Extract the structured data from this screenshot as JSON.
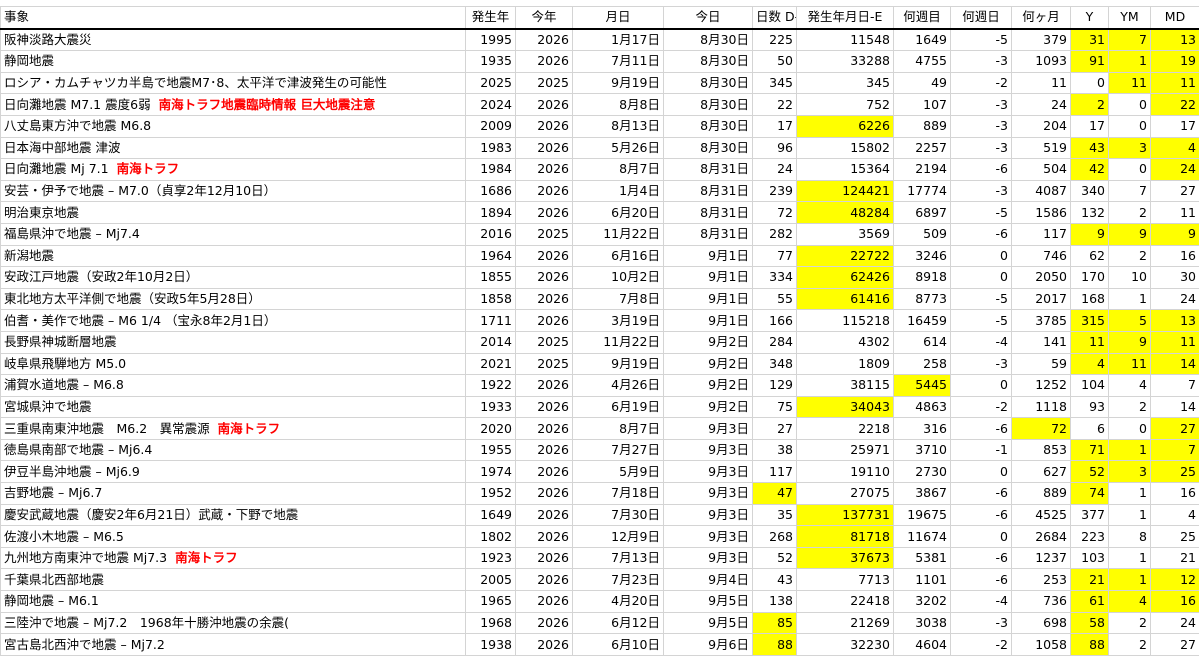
{
  "colors": {
    "highlight": "#ffff00",
    "alert_text": "#ff0000",
    "grid": "#d4d4d4"
  },
  "headers": [
    "事象",
    "発生年",
    "今年",
    "月日",
    "今日",
    "日数 D-E",
    "発生年月日-E",
    "何週目",
    "何週日",
    "何ヶ月",
    "Y",
    "YM",
    "MD"
  ],
  "rows": [
    {
      "event": "阪神淡路大震災",
      "tag": "",
      "birth_year": "1995",
      "this_year": "2026",
      "md": "1月17日",
      "today": "8月30日",
      "days": "225",
      "total_days": "11548",
      "weeks": "1649",
      "weekday": "-5",
      "months": "379",
      "y": "31",
      "ym": "7",
      "d": "13",
      "hl": [
        "y",
        "ym",
        "d"
      ],
      "red": []
    },
    {
      "event": "静岡地震",
      "tag": "",
      "birth_year": "1935",
      "this_year": "2026",
      "md": "7月11日",
      "today": "8月30日",
      "days": "50",
      "total_days": "33288",
      "weeks": "4755",
      "weekday": "-3",
      "months": "1093",
      "y": "91",
      "ym": "1",
      "d": "19",
      "hl": [
        "y",
        "ym",
        "d"
      ],
      "red": [
        "y",
        "ym",
        "d"
      ]
    },
    {
      "event": "ロシア・カムチャツカ半島で地震M7･8、太平洋で津波発生の可能性",
      "tag": "",
      "birth_year": "2025",
      "this_year": "2025",
      "md": "9月19日",
      "today": "8月30日",
      "days": "345",
      "total_days": "345",
      "weeks": "49",
      "weekday": "-2",
      "months": "11",
      "y": "0",
      "ym": "11",
      "d": "11",
      "hl": [
        "ym",
        "d"
      ],
      "red": []
    },
    {
      "event": "日向灘地震 M7.1 震度6弱",
      "tag": "南海トラフ地震臨時情報 巨大地震注意",
      "birth_year": "2024",
      "this_year": "2026",
      "md": "8月8日",
      "today": "8月30日",
      "days": "22",
      "total_days": "752",
      "weeks": "107",
      "weekday": "-3",
      "months": "24",
      "y": "2",
      "ym": "0",
      "d": "22",
      "hl": [
        "y",
        "d"
      ],
      "red": []
    },
    {
      "event": "八丈島東方沖で地震 M6.8",
      "tag": "",
      "birth_year": "2009",
      "this_year": "2026",
      "md": "8月13日",
      "today": "8月30日",
      "days": "17",
      "total_days": "6226",
      "weeks": "889",
      "weekday": "-3",
      "months": "204",
      "y": "17",
      "ym": "0",
      "d": "17",
      "hl": [
        "total_days"
      ],
      "red": []
    },
    {
      "event": "日本海中部地震 津波",
      "tag": "",
      "birth_year": "1983",
      "this_year": "2026",
      "md": "5月26日",
      "today": "8月30日",
      "days": "96",
      "total_days": "15802",
      "weeks": "2257",
      "weekday": "-3",
      "months": "519",
      "y": "43",
      "ym": "3",
      "d": "4",
      "hl": [
        "y",
        "ym",
        "d"
      ],
      "red": []
    },
    {
      "event": "日向灘地震 Mj 7.1",
      "tag": "南海トラフ",
      "birth_year": "1984",
      "this_year": "2026",
      "md": "8月7日",
      "today": "8月31日",
      "days": "24",
      "total_days": "15364",
      "weeks": "2194",
      "weekday": "-6",
      "months": "504",
      "y": "42",
      "ym": "0",
      "d": "24",
      "hl": [
        "y",
        "d"
      ],
      "red": [
        "today"
      ]
    },
    {
      "event": "安芸・伊予で地震 – M7.0（貞享2年12月10日）",
      "tag": "",
      "birth_year": "1686",
      "this_year": "2026",
      "md": "1月4日",
      "today": "8月31日",
      "days": "239",
      "total_days": "124421",
      "weeks": "17774",
      "weekday": "-3",
      "months": "4087",
      "y": "340",
      "ym": "7",
      "d": "27",
      "hl": [
        "total_days"
      ],
      "red": []
    },
    {
      "event": "明治東京地震",
      "tag": "",
      "birth_year": "1894",
      "this_year": "2026",
      "md": "6月20日",
      "today": "8月31日",
      "days": "72",
      "total_days": "48284",
      "weeks": "6897",
      "weekday": "-5",
      "months": "1586",
      "y": "132",
      "ym": "2",
      "d": "11",
      "hl": [
        "total_days"
      ],
      "red": []
    },
    {
      "event": "福島県沖で地震 – Mj7.4",
      "tag": "",
      "birth_year": "2016",
      "this_year": "2025",
      "md": "11月22日",
      "today": "8月31日",
      "days": "282",
      "total_days": "3569",
      "weeks": "509",
      "weekday": "-6",
      "months": "117",
      "y": "9",
      "ym": "9",
      "d": "9",
      "hl": [
        "y",
        "ym",
        "d"
      ],
      "red": []
    },
    {
      "event": "新潟地震",
      "tag": "",
      "birth_year": "1964",
      "this_year": "2026",
      "md": "6月16日",
      "today": "9月1日",
      "days": "77",
      "total_days": "22722",
      "weeks": "3246",
      "weekday": "0",
      "months": "746",
      "y": "62",
      "ym": "2",
      "d": "16",
      "hl": [
        "total_days"
      ],
      "red": []
    },
    {
      "event": "安政江戸地震（安政2年10月2日）",
      "tag": "",
      "birth_year": "1855",
      "this_year": "2026",
      "md": "10月2日",
      "today": "9月1日",
      "days": "334",
      "total_days": "62426",
      "weeks": "8918",
      "weekday": "0",
      "months": "2050",
      "y": "170",
      "ym": "10",
      "d": "30",
      "hl": [
        "total_days"
      ],
      "red": []
    },
    {
      "event": "東北地方太平洋側で地震（安政5年5月28日）",
      "tag": "",
      "birth_year": "1858",
      "this_year": "2026",
      "md": "7月8日",
      "today": "9月1日",
      "days": "55",
      "total_days": "61416",
      "weeks": "8773",
      "weekday": "-5",
      "months": "2017",
      "y": "168",
      "ym": "1",
      "d": "24",
      "hl": [
        "total_days"
      ],
      "red": []
    },
    {
      "event": "伯耆・美作で地震 – M6 1/4 （宝永8年2月1日）",
      "tag": "",
      "birth_year": "1711",
      "this_year": "2026",
      "md": "3月19日",
      "today": "9月1日",
      "days": "166",
      "total_days": "115218",
      "weeks": "16459",
      "weekday": "-5",
      "months": "3785",
      "y": "315",
      "ym": "5",
      "d": "13",
      "hl": [
        "y",
        "ym",
        "d"
      ],
      "red": []
    },
    {
      "event": "長野県神城断層地震",
      "tag": "",
      "birth_year": "2014",
      "this_year": "2025",
      "md": "11月22日",
      "today": "9月2日",
      "days": "284",
      "total_days": "4302",
      "weeks": "614",
      "weekday": "-4",
      "months": "141",
      "y": "11",
      "ym": "9",
      "d": "11",
      "hl": [
        "y",
        "ym",
        "d"
      ],
      "red": []
    },
    {
      "event": "岐阜県飛騨地方 M5.0",
      "tag": "",
      "birth_year": "2021",
      "this_year": "2025",
      "md": "9月19日",
      "today": "9月2日",
      "days": "348",
      "total_days": "1809",
      "weeks": "258",
      "weekday": "-3",
      "months": "59",
      "y": "4",
      "ym": "11",
      "d": "14",
      "hl": [
        "y",
        "ym",
        "d"
      ],
      "red": []
    },
    {
      "event": "浦賀水道地震 – M6.8",
      "tag": "",
      "birth_year": "1922",
      "this_year": "2026",
      "md": "4月26日",
      "today": "9月2日",
      "days": "129",
      "total_days": "38115",
      "weeks": "5445",
      "weekday": "0",
      "months": "1252",
      "y": "104",
      "ym": "4",
      "d": "7",
      "hl": [
        "weeks"
      ],
      "red": []
    },
    {
      "event": "宮城県沖で地震",
      "tag": "",
      "birth_year": "1933",
      "this_year": "2026",
      "md": "6月19日",
      "today": "9月2日",
      "days": "75",
      "total_days": "34043",
      "weeks": "4863",
      "weekday": "-2",
      "months": "1118",
      "y": "93",
      "ym": "2",
      "d": "14",
      "hl": [
        "total_days"
      ],
      "red": []
    },
    {
      "event": "三重県南東沖地震　M6.2　異常震源",
      "tag": "南海トラフ",
      "birth_year": "2020",
      "this_year": "2026",
      "md": "8月7日",
      "today": "9月3日",
      "days": "27",
      "total_days": "2218",
      "weeks": "316",
      "weekday": "-6",
      "months": "72",
      "y": "6",
      "ym": "0",
      "d": "27",
      "hl": [
        "months",
        "d"
      ],
      "red": []
    },
    {
      "event": "徳島県南部で地震 – Mj6.4",
      "tag": "",
      "birth_year": "1955",
      "this_year": "2026",
      "md": "7月27日",
      "today": "9月3日",
      "days": "38",
      "total_days": "25971",
      "weeks": "3710",
      "weekday": "-1",
      "months": "853",
      "y": "71",
      "ym": "1",
      "d": "7",
      "hl": [
        "y",
        "ym",
        "d"
      ],
      "red": []
    },
    {
      "event": "伊豆半島沖地震 – Mj6.9",
      "tag": "",
      "birth_year": "1974",
      "this_year": "2026",
      "md": "5月9日",
      "today": "9月3日",
      "days": "117",
      "total_days": "19110",
      "weeks": "2730",
      "weekday": "0",
      "months": "627",
      "y": "52",
      "ym": "3",
      "d": "25",
      "hl": [
        "y",
        "ym",
        "d"
      ],
      "red": []
    },
    {
      "event": "吉野地震 – Mj6.7",
      "tag": "",
      "birth_year": "1952",
      "this_year": "2026",
      "md": "7月18日",
      "today": "9月3日",
      "days": "47",
      "total_days": "27075",
      "weeks": "3867",
      "weekday": "-6",
      "months": "889",
      "y": "74",
      "ym": "1",
      "d": "16",
      "hl": [
        "days",
        "y"
      ],
      "red": []
    },
    {
      "event": "慶安武蔵地震（慶安2年6月21日）武蔵・下野で地震",
      "tag": "",
      "birth_year": "1649",
      "this_year": "2026",
      "md": "7月30日",
      "today": "9月3日",
      "days": "35",
      "total_days": "137731",
      "weeks": "19675",
      "weekday": "-6",
      "months": "4525",
      "y": "377",
      "ym": "1",
      "d": "4",
      "hl": [
        "total_days"
      ],
      "red": []
    },
    {
      "event": "佐渡小木地震 – M6.5",
      "tag": "",
      "birth_year": "1802",
      "this_year": "2026",
      "md": "12月9日",
      "today": "9月3日",
      "days": "268",
      "total_days": "81718",
      "weeks": "11674",
      "weekday": "0",
      "months": "2684",
      "y": "223",
      "ym": "8",
      "d": "25",
      "hl": [
        "total_days"
      ],
      "red": []
    },
    {
      "event": "九州地方南東沖で地震 Mj7.3",
      "tag": "南海トラフ",
      "birth_year": "1923",
      "this_year": "2026",
      "md": "7月13日",
      "today": "9月3日",
      "days": "52",
      "total_days": "37673",
      "weeks": "5381",
      "weekday": "-6",
      "months": "1237",
      "y": "103",
      "ym": "1",
      "d": "21",
      "hl": [
        "total_days"
      ],
      "red": []
    },
    {
      "event": "千葉県北西部地震",
      "tag": "",
      "birth_year": "2005",
      "this_year": "2026",
      "md": "7月23日",
      "today": "9月4日",
      "days": "43",
      "total_days": "7713",
      "weeks": "1101",
      "weekday": "-6",
      "months": "253",
      "y": "21",
      "ym": "1",
      "d": "12",
      "hl": [
        "y",
        "ym",
        "d"
      ],
      "red": []
    },
    {
      "event": "静岡地震 – M6.1",
      "tag": "",
      "birth_year": "1965",
      "this_year": "2026",
      "md": "4月20日",
      "today": "9月5日",
      "days": "138",
      "total_days": "22418",
      "weeks": "3202",
      "weekday": "-4",
      "months": "736",
      "y": "61",
      "ym": "4",
      "d": "16",
      "hl": [
        "y",
        "ym",
        "d"
      ],
      "red": []
    },
    {
      "event": "三陸沖で地震 – Mj7.2　1968年十勝沖地震の余震(",
      "tag": "",
      "birth_year": "1968",
      "this_year": "2026",
      "md": "6月12日",
      "today": "9月5日",
      "days": "85",
      "total_days": "21269",
      "weeks": "3038",
      "weekday": "-3",
      "months": "698",
      "y": "58",
      "ym": "2",
      "d": "24",
      "hl": [
        "days",
        "y"
      ],
      "red": []
    },
    {
      "event": "宮古島北西沖で地震 – Mj7.2",
      "tag": "",
      "birth_year": "1938",
      "this_year": "2026",
      "md": "6月10日",
      "today": "9月6日",
      "days": "88",
      "total_days": "32230",
      "weeks": "4604",
      "weekday": "-2",
      "months": "1058",
      "y": "88",
      "ym": "2",
      "d": "27",
      "hl": [
        "days",
        "y"
      ],
      "red": []
    }
  ]
}
